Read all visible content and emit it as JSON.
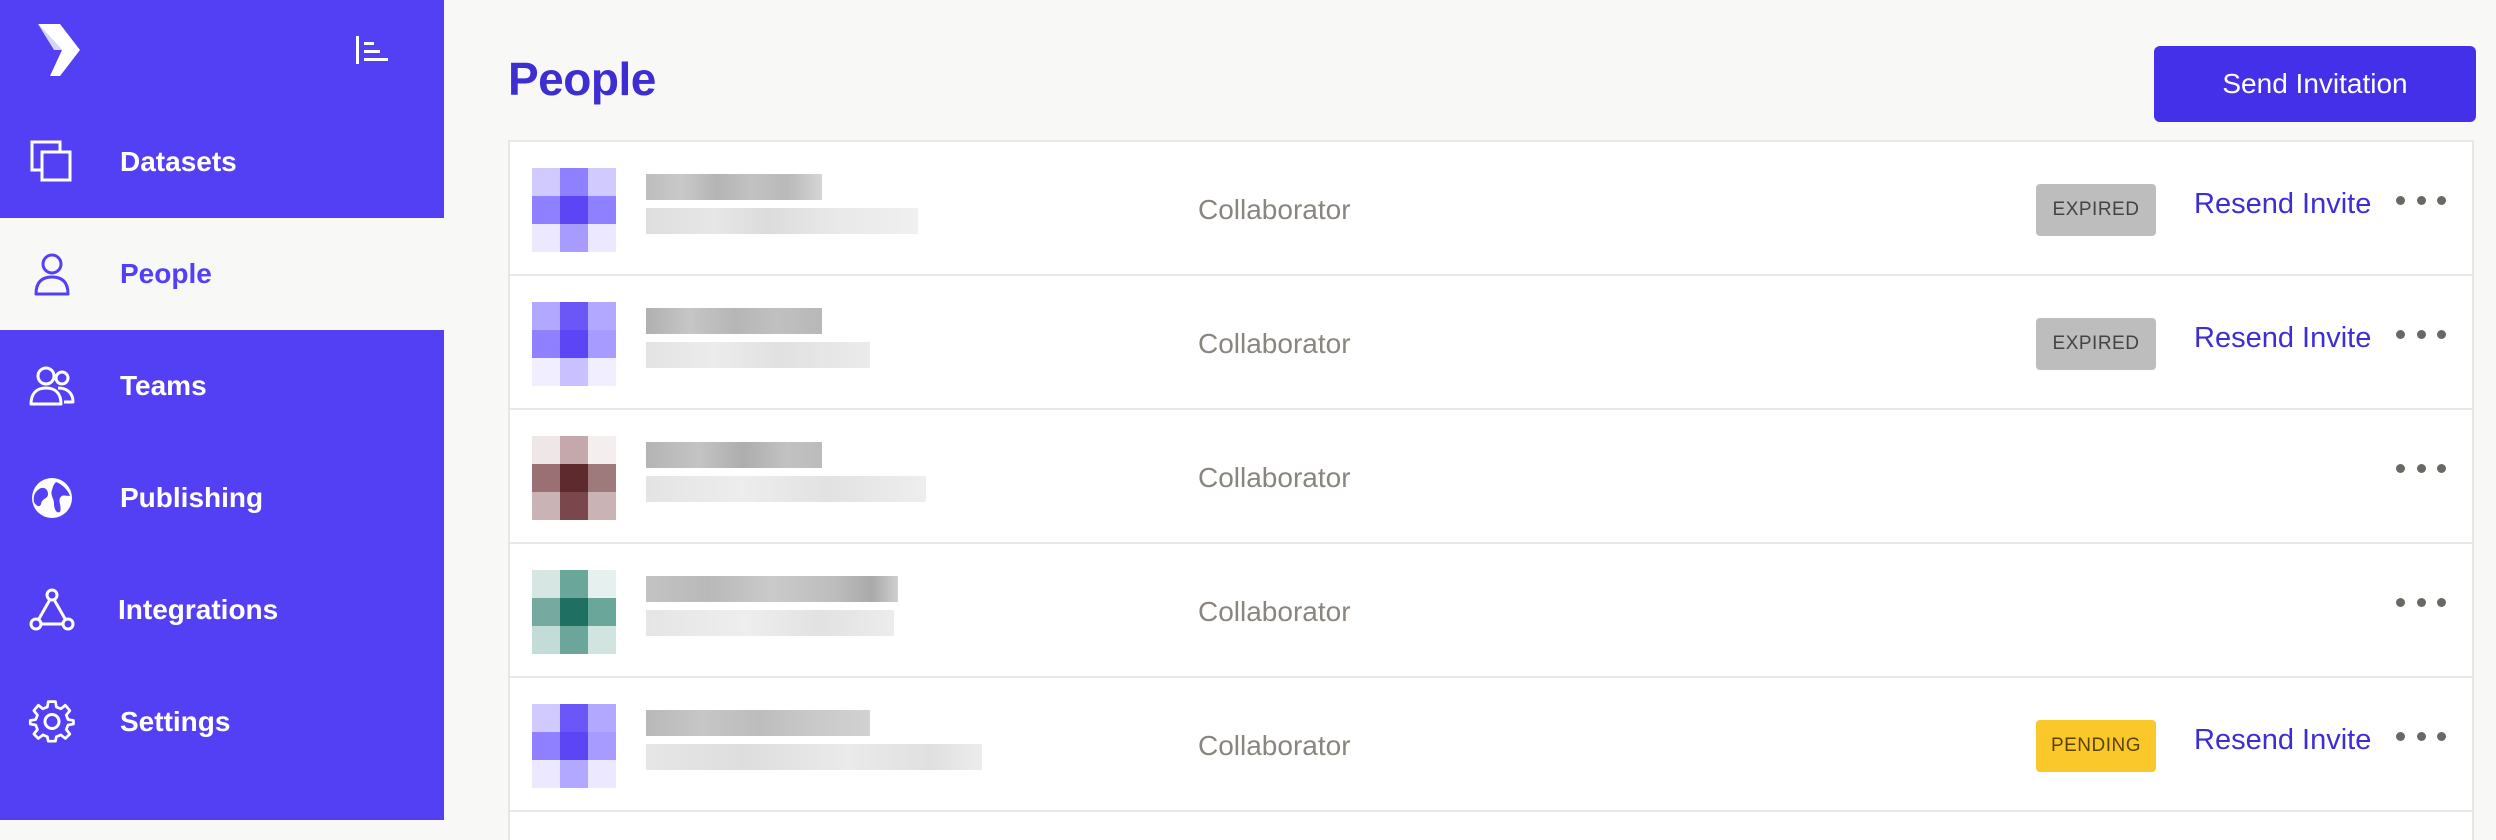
{
  "sidebar": {
    "items": [
      {
        "label": "Datasets",
        "icon": "datasets-icon",
        "active": false
      },
      {
        "label": "People",
        "icon": "person-icon",
        "active": true
      },
      {
        "label": "Teams",
        "icon": "people-group-icon",
        "active": false
      },
      {
        "label": "Publishing",
        "icon": "globe-icon",
        "active": false
      },
      {
        "label": "Integrations",
        "icon": "network-nodes-icon",
        "active": false
      },
      {
        "label": "Settings",
        "icon": "gear-icon",
        "active": false
      }
    ]
  },
  "header": {
    "title": "People",
    "send_invitation_label": "Send Invitation"
  },
  "people": [
    {
      "role": "Collaborator",
      "status": "EXPIRED",
      "action": "Resend Invite",
      "avatar_color": "#5b45f5"
    },
    {
      "role": "Collaborator",
      "status": "EXPIRED",
      "action": "Resend Invite",
      "avatar_color": "#5b45f5"
    },
    {
      "role": "Collaborator",
      "status": "",
      "action": "",
      "avatar_color": "#5e2a2e"
    },
    {
      "role": "Collaborator",
      "status": "",
      "action": "",
      "avatar_color": "#1f6f62"
    },
    {
      "role": "Collaborator",
      "status": "PENDING",
      "action": "Resend Invite",
      "avatar_color": "#5b45f5"
    }
  ],
  "colors": {
    "sidebar": "#5340f5",
    "accent": "#4530ea",
    "title": "#3d2ed4",
    "expired_badge": "#bdbdbd",
    "pending_badge": "#fbc82b"
  }
}
